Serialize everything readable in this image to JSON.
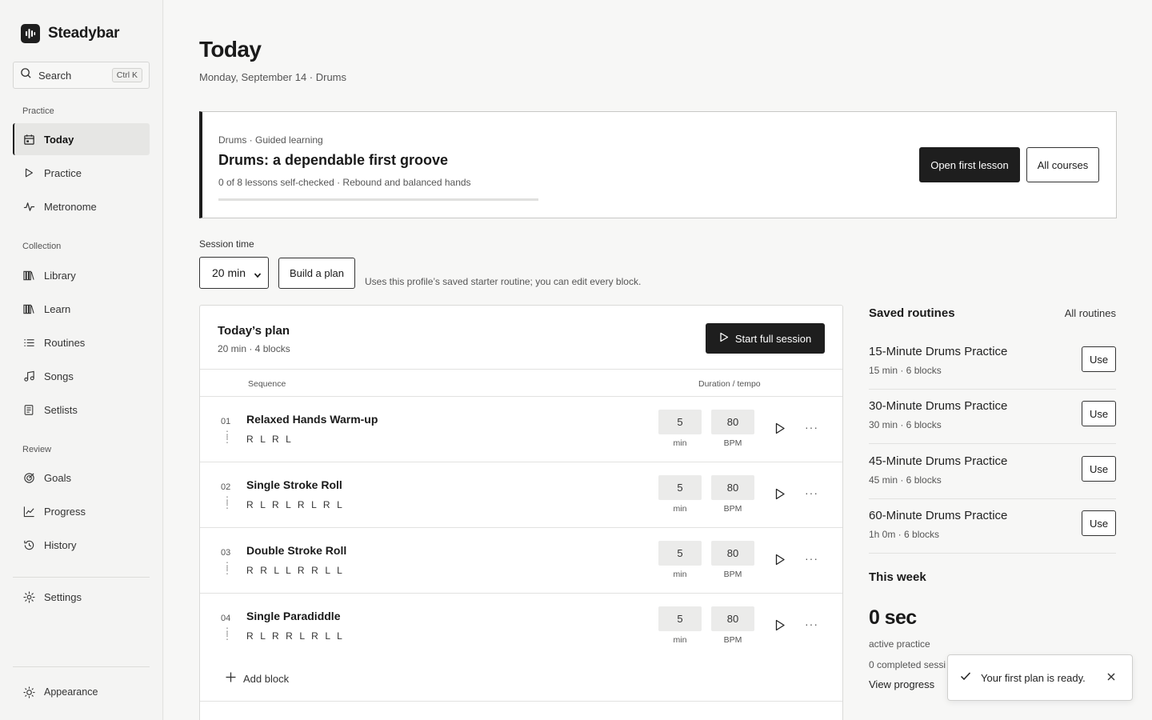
{
  "app": {
    "name": "Steadybar",
    "logo_icon": "waveform-icon"
  },
  "search": {
    "label": "Search",
    "shortcut": "Ctrl K"
  },
  "sidebar": {
    "sections": {
      "practice": "Practice",
      "collection": "Collection",
      "review": "Review"
    },
    "items": [
      {
        "label": "Today",
        "icon": "calendar-icon",
        "active": true
      },
      {
        "label": "Practice",
        "icon": "play-icon"
      },
      {
        "label": "Metronome",
        "icon": "pulse-icon"
      },
      {
        "label": "Library",
        "icon": "books-icon"
      },
      {
        "label": "Learn",
        "icon": "books-icon"
      },
      {
        "label": "Routines",
        "icon": "list-icon"
      },
      {
        "label": "Songs",
        "icon": "music-note-icon"
      },
      {
        "label": "Setlists",
        "icon": "setlist-icon"
      },
      {
        "label": "Goals",
        "icon": "target-icon"
      },
      {
        "label": "Progress",
        "icon": "chart-line-icon"
      },
      {
        "label": "History",
        "icon": "history-icon"
      },
      {
        "label": "Settings",
        "icon": "gear-icon"
      }
    ],
    "appearance": "Appearance"
  },
  "page": {
    "title": "Today",
    "subtitle": "Monday, September 14 · Drums"
  },
  "course": {
    "eyebrow": "Drums · Guided learning",
    "title": "Drums: a dependable first groove",
    "meta": "0 of 8 lessons self-checked · Rebound and balanced hands",
    "progress": 0,
    "primary_button": "Open first lesson",
    "secondary_button": "All courses"
  },
  "session": {
    "label": "Session time",
    "selected": "20 min",
    "build_button": "Build a plan",
    "note": "Uses this profile’s saved starter routine; you can edit every block."
  },
  "plan": {
    "title": "Today’s plan",
    "meta": "20 min · 4 blocks",
    "start_button": "Start full session",
    "col_sequence": "Sequence",
    "col_duration": "Duration / tempo",
    "blocks": [
      {
        "num": "01",
        "name": "Relaxed Hands Warm-up",
        "sequence": "R L R L",
        "duration": "5",
        "duration_unit": "min",
        "tempo": "80",
        "tempo_unit": "BPM"
      },
      {
        "num": "02",
        "name": "Single Stroke Roll",
        "sequence": "R L R L R L R L",
        "duration": "5",
        "duration_unit": "min",
        "tempo": "80",
        "tempo_unit": "BPM"
      },
      {
        "num": "03",
        "name": "Double Stroke Roll",
        "sequence": "R R L L R R L L",
        "duration": "5",
        "duration_unit": "min",
        "tempo": "80",
        "tempo_unit": "BPM"
      },
      {
        "num": "04",
        "name": "Single Paradiddle",
        "sequence": "R L R R L R L L",
        "duration": "5",
        "duration_unit": "min",
        "tempo": "80",
        "tempo_unit": "BPM"
      }
    ],
    "add_block": "Add block"
  },
  "routines": {
    "title": "Saved routines",
    "all_link": "All routines",
    "use_label": "Use",
    "items": [
      {
        "name": "15-Minute Drums Practice",
        "meta": "15 min · 6 blocks"
      },
      {
        "name": "30-Minute Drums Practice",
        "meta": "30 min · 6 blocks"
      },
      {
        "name": "45-Minute Drums Practice",
        "meta": "45 min · 6 blocks"
      },
      {
        "name": "60-Minute Drums Practice",
        "meta": "1h 0m · 6 blocks"
      }
    ]
  },
  "week": {
    "title": "This week",
    "total": "0 sec",
    "total_label": "active practice",
    "completed": "0 completed sessi",
    "link": "View progress"
  },
  "toast": {
    "message": "Your first plan is ready."
  }
}
